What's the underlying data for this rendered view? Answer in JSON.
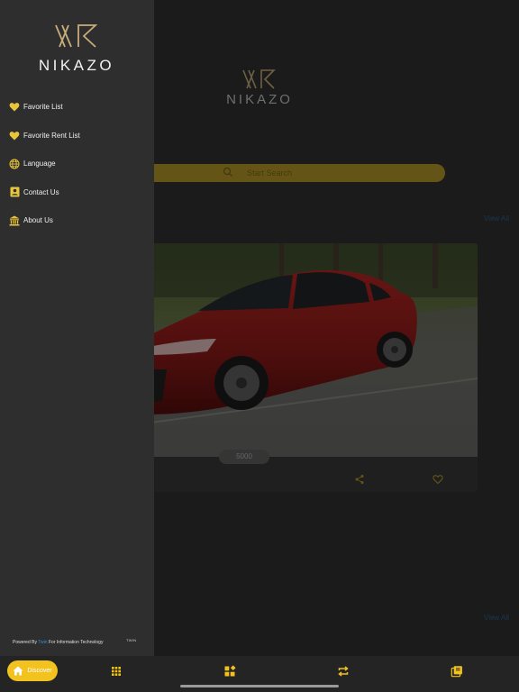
{
  "brand": {
    "name": "NIKAZO"
  },
  "search": {
    "placeholder": "Start Search"
  },
  "sections": {
    "view_all_top": "View All",
    "view_all_bottom": "View All"
  },
  "car": {
    "price": "5000"
  },
  "drawer": {
    "items": [
      {
        "label": "Favorite List",
        "icon": "heart-icon"
      },
      {
        "label": "Favorite Rent List",
        "icon": "heart-icon"
      },
      {
        "label": "Language",
        "icon": "globe-icon"
      },
      {
        "label": "Contact Us",
        "icon": "contact-card-icon"
      },
      {
        "label": "About Us",
        "icon": "bank-icon"
      }
    ],
    "powered_prefix": "Powered By",
    "powered_brand": "Twin",
    "powered_suffix": "For Information Technology",
    "footer_logo": "TWIN"
  },
  "tabbar": {
    "discover_label": "Discover",
    "accent": "#f2c21e"
  },
  "colors": {
    "accent": "#f2c21e",
    "link": "#1e4e73",
    "drawer_bg": "#2e2e2e"
  }
}
